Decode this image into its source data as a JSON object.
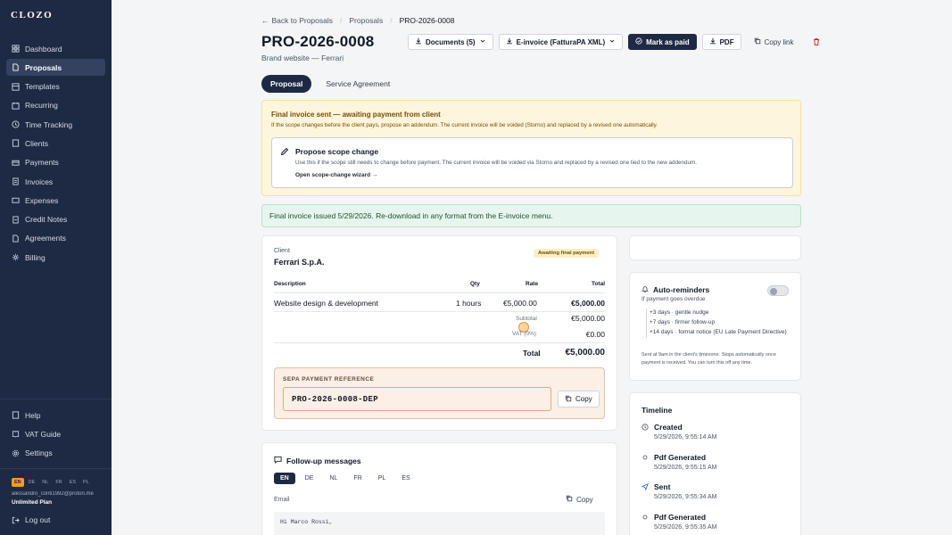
{
  "app": {
    "logo": "CLOZO"
  },
  "sidebar": {
    "items": [
      {
        "label": "Dashboard",
        "icon": "grid-icon"
      },
      {
        "label": "Proposals",
        "icon": "document-icon",
        "active": true
      },
      {
        "label": "Templates",
        "icon": "template-icon"
      },
      {
        "label": "Recurring",
        "icon": "recurring-icon"
      },
      {
        "label": "Time Tracking",
        "icon": "clock-icon"
      },
      {
        "label": "Clients",
        "icon": "users-icon"
      },
      {
        "label": "Payments",
        "icon": "card-icon"
      },
      {
        "label": "Invoices",
        "icon": "invoice-icon"
      },
      {
        "label": "Expenses",
        "icon": "expense-icon"
      },
      {
        "label": "Credit Notes",
        "icon": "credit-note-icon"
      },
      {
        "label": "Agreements",
        "icon": "agreement-icon"
      },
      {
        "label": "Billing",
        "icon": "billing-icon"
      }
    ],
    "bottom": [
      {
        "label": "Help",
        "icon": "help-icon"
      },
      {
        "label": "VAT Guide",
        "icon": "book-icon"
      },
      {
        "label": "Settings",
        "icon": "gear-icon"
      }
    ],
    "langs": [
      "EN",
      "DE",
      "NL",
      "FR",
      "ES",
      "PL"
    ],
    "user_email": "alessandro_conti1992@proton.me",
    "plan": "Unlimited Plan",
    "logout": "Log out"
  },
  "breadcrumb": {
    "back": "Back to Proposals",
    "section": "Proposals",
    "current": "PRO-2026-0008"
  },
  "header": {
    "title": "PRO-2026-0008",
    "subtitle": "Brand website — Ferrari",
    "documents": "Documents (5)",
    "einvoice": "E-invoice (FatturaPA XML)",
    "mark_paid": "Mark as paid",
    "pdf": "PDF",
    "copy_link": "Copy link"
  },
  "tabs": [
    "Proposal",
    "Service Agreement"
  ],
  "notice": {
    "title": "Final invoice sent — awaiting payment from client",
    "text": "If the scope changes before the client pays, propose an addendum. The current invoice will be voided (Storno) and replaced by a revised one automatically.",
    "scope_title": "Propose scope change",
    "scope_text": "Use this if the scope still needs to change before payment. The current invoice will be voided via Storno and replaced by a revised one tied to the new addendum.",
    "scope_link": "Open scope-change wizard →"
  },
  "issued": "Final invoice issued 5/29/2026. Re-download in any format from the E-invoice menu.",
  "invoice": {
    "client_label": "Client",
    "client": "Ferrari S.p.A.",
    "badge": "Awaiting final payment",
    "headers": {
      "desc": "Description",
      "qty": "Qty",
      "rate": "Rate",
      "total": "Total"
    },
    "row": {
      "desc": "Website design & development",
      "qty": "1 hours",
      "rate": "€5,000.00",
      "total": "€5,000.00"
    },
    "subtotal_label": "Subtotal",
    "subtotal": "€5,000.00",
    "vat_label": "VAT (0%)",
    "vat": "€0.00",
    "total_label": "Total",
    "total": "€5,000.00",
    "sepa_label": "SEPA PAYMENT REFERENCE",
    "sepa_ref": "PRO-2026-0008-DEP",
    "copy": "Copy"
  },
  "followup": {
    "title": "Follow-up messages",
    "langs": [
      "EN",
      "DE",
      "NL",
      "FR",
      "PL",
      "ES"
    ],
    "email_label": "Email",
    "copy": "Copy",
    "email_body": "Hi Marco Rossi,"
  },
  "reminders": {
    "title": "Auto-reminders",
    "sub": "If payment goes overdue",
    "items": [
      "+3 days · gentle nudge",
      "+7 days · firmer follow-up",
      "+14 days · formal notice (EU Late Payment Directive)"
    ],
    "note": "Sent at 9am in the client's timezone. Stops automatically once payment is received. You can turn this off any time."
  },
  "timeline": {
    "title": "Timeline",
    "items": [
      {
        "name": "Created",
        "date": "5/29/2026, 9:55:14 AM",
        "icon": "clock-icon"
      },
      {
        "name": "Pdf Generated",
        "date": "5/29/2026, 9:55:15 AM",
        "icon": "dot-icon"
      },
      {
        "name": "Sent",
        "date": "5/29/2026, 9:55:34 AM",
        "icon": "send-icon"
      },
      {
        "name": "Pdf Generated",
        "date": "5/29/2026, 9:55:35 AM",
        "icon": "dot-icon"
      }
    ]
  },
  "colors": {
    "sidebar": "#1e2a44",
    "accent_dark": "#1e2a44",
    "warning_bg": "#fdf6dc",
    "success_bg": "#e6f6ee",
    "sepa_bg": "#fbefe6"
  }
}
